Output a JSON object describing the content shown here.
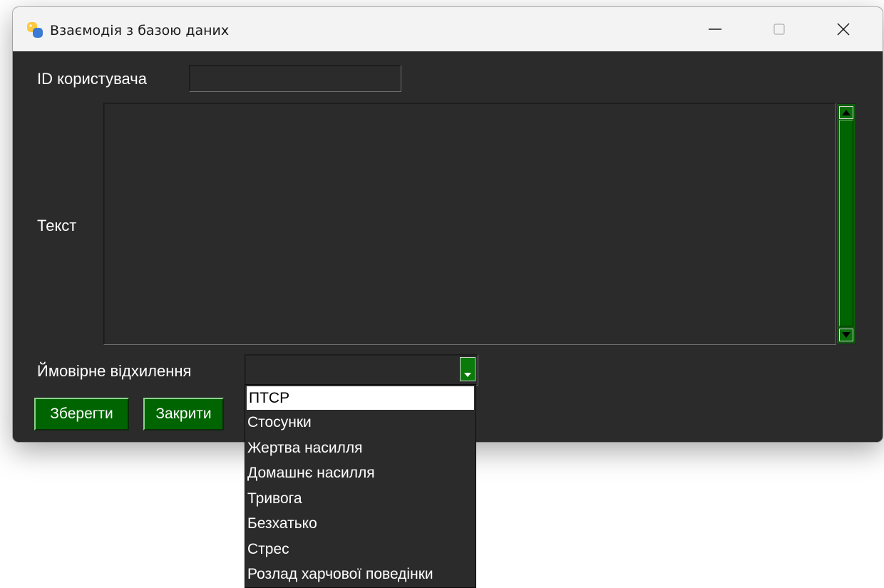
{
  "window": {
    "title": "Взаємодія з базою даних"
  },
  "form": {
    "user_id_label": "ID користувача",
    "user_id_value": "",
    "text_label": "Текст",
    "text_value": "",
    "deviation_label": "Ймовірне відхилення",
    "deviation_selected": ""
  },
  "buttons": {
    "save_label": "Зберегти",
    "close_label": "Закрити"
  },
  "dropdown": {
    "options": [
      "ПТСР",
      "Стосунки",
      "Жертва насилля",
      "Домашнє насилля",
      "Тривога",
      "Безхатько",
      "Стрес",
      "Розлад харчової поведінки"
    ],
    "highlighted": "ПТСР"
  },
  "colors": {
    "window_bg": "#2b2b2b",
    "accent_green": "#006400",
    "titlebar_bg": "#f3f3f3"
  }
}
